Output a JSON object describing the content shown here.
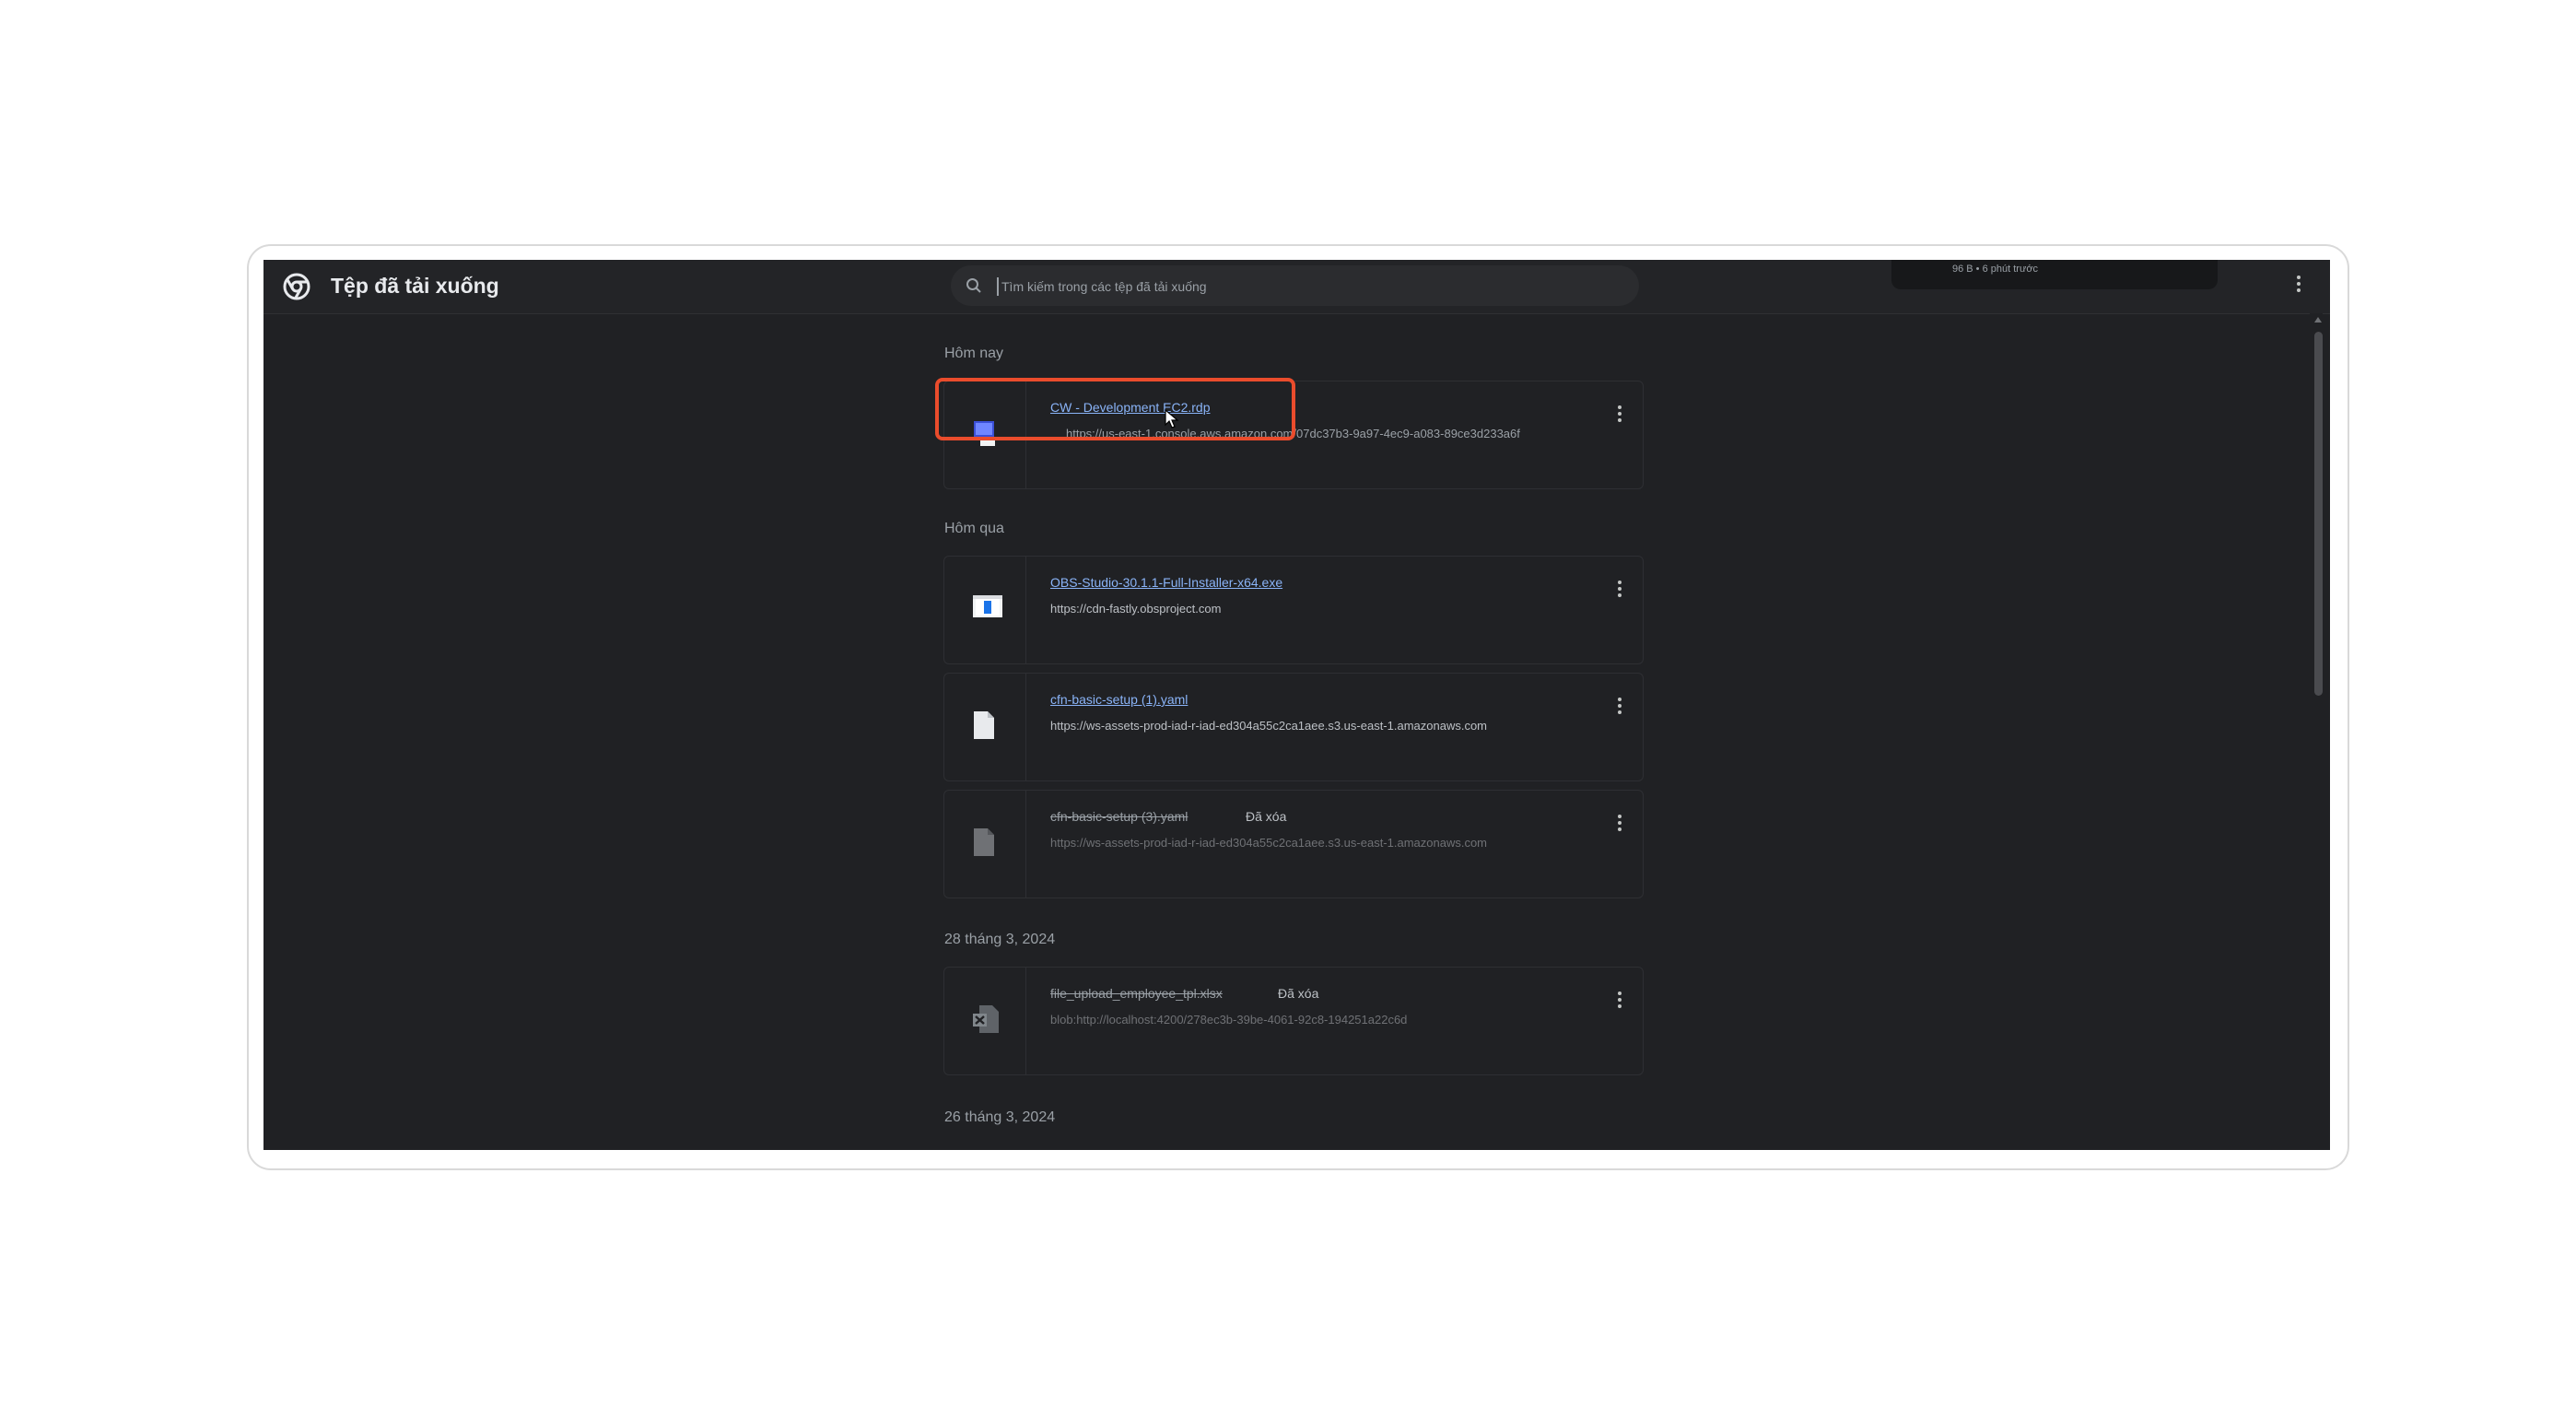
{
  "header": {
    "title": "Tệp đã tải xuống",
    "search_placeholder": "Tìm kiếm trong các tệp đã tải xuống",
    "download_bubble_text": "96 B • 6 phút trước"
  },
  "sections": [
    {
      "label": "Hôm nay",
      "items": [
        {
          "name": "CW - Development EC2.rdp",
          "url": "https://us-east-1.console.aws.amazon.com/07dc37b3-9a97-4ec9-a083-89ce3d233a6f",
          "status": "",
          "icon": "remote-desktop-icon",
          "highlighted": true
        }
      ]
    },
    {
      "label": "Hôm qua",
      "items": [
        {
          "name": "OBS-Studio-30.1.1-Full-Installer-x64.exe",
          "url": "https://cdn-fastly.obsproject.com",
          "status": "",
          "icon": "installer-icon"
        },
        {
          "name": "cfn-basic-setup (1).yaml",
          "url": "https://ws-assets-prod-iad-r-iad-ed304a55c2ca1aee.s3.us-east-1.amazonaws.com",
          "status": "",
          "icon": "document-icon"
        },
        {
          "name": "cfn-basic-setup (3).yaml",
          "url": "https://ws-assets-prod-iad-r-iad-ed304a55c2ca1aee.s3.us-east-1.amazonaws.com",
          "status": "Đã xóa",
          "icon": "document-icon"
        }
      ]
    },
    {
      "label": "28 tháng 3, 2024",
      "items": [
        {
          "name": "file_upload_employee_tpl.xlsx",
          "url": "blob:http://localhost:4200/278ec3b-39be-4061-92c8-194251a22c6d",
          "status": "Đã xóa",
          "icon": "excel-file-icon"
        }
      ]
    },
    {
      "label": "26 tháng 3, 2024",
      "items": []
    }
  ],
  "colors": {
    "background": "#202124",
    "link": "#8ab4f8",
    "highlight": "#ea4c2c"
  }
}
